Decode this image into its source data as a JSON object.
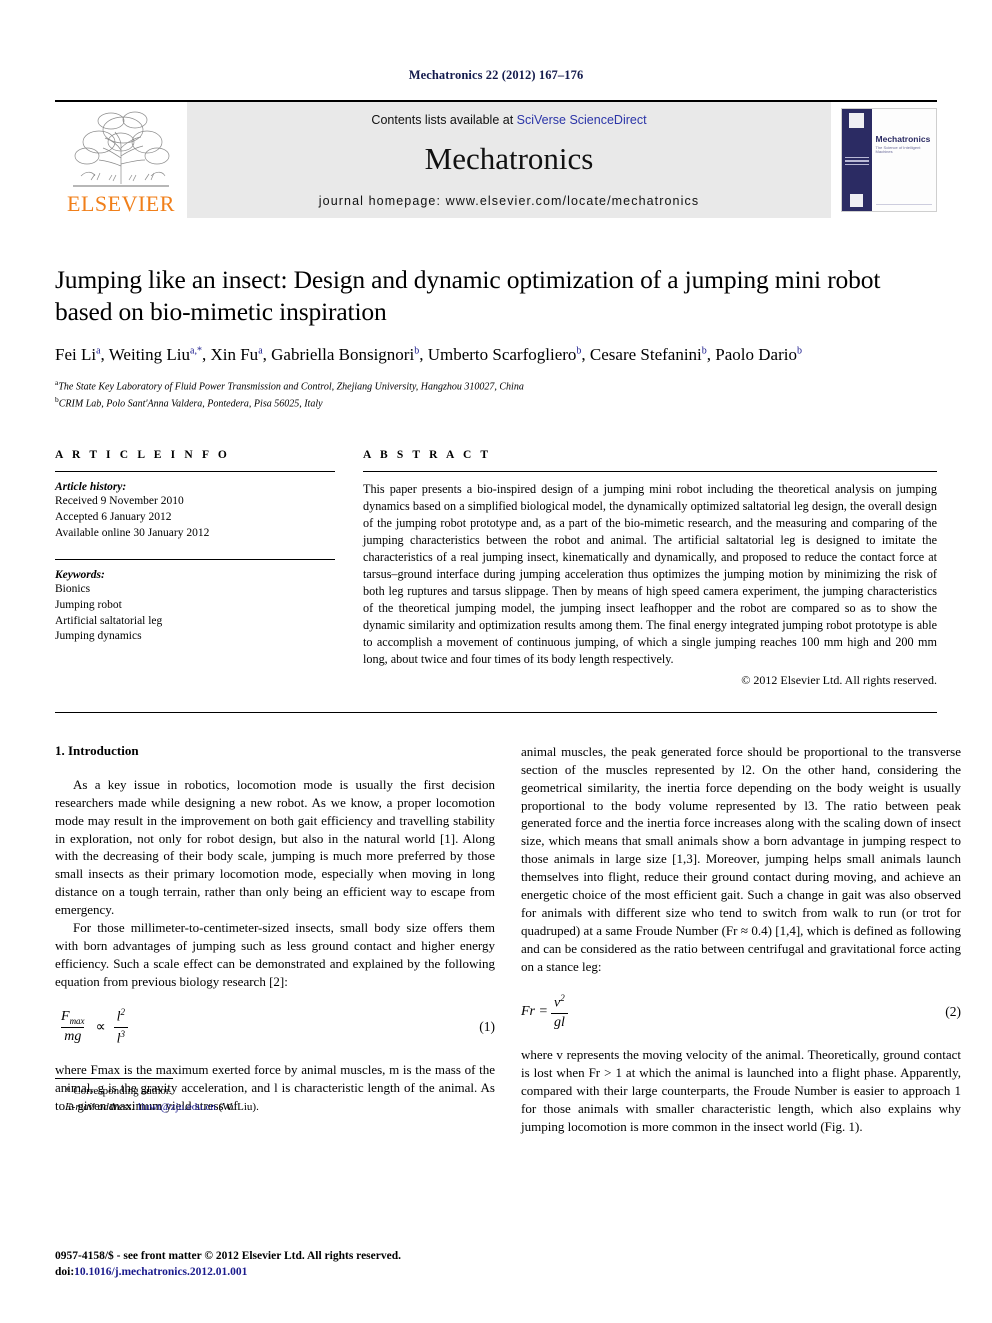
{
  "running_head": "Mechatronics 22 (2012) 167–176",
  "masthead": {
    "publisher_name": "ELSEVIER",
    "contents_prefix": "Contents lists available at ",
    "contents_link": "SciVerse ScienceDirect",
    "journal_title": "Mechatronics",
    "homepage": "journal homepage: www.elsevier.com/locate/mechatronics",
    "cover": {
      "title": "Mechatronics",
      "subtitle": "The Science of Intelligent Machines"
    }
  },
  "article": {
    "title": "Jumping like an insect: Design and dynamic optimization of a jumping mini robot based on bio-mimetic inspiration",
    "authors": [
      {
        "name": "Fei Li",
        "sup": "a"
      },
      {
        "name": "Weiting Liu",
        "sup": "a,*"
      },
      {
        "name": "Xin Fu",
        "sup": "a"
      },
      {
        "name": "Gabriella Bonsignori",
        "sup": "b"
      },
      {
        "name": "Umberto Scarfogliero",
        "sup": "b"
      },
      {
        "name": "Cesare Stefanini",
        "sup": "b"
      },
      {
        "name": "Paolo Dario",
        "sup": "b"
      }
    ],
    "affiliations": [
      {
        "mark": "a",
        "text": "The State Key Laboratory of Fluid Power Transmission and Control, Zhejiang University, Hangzhou 310027, China"
      },
      {
        "mark": "b",
        "text": "CRIM Lab, Polo Sant'Anna Valdera, Pontedera, Pisa 56025, Italy"
      }
    ]
  },
  "article_info": {
    "heading": "A R T I C L E   I N F O",
    "history_label": "Article history:",
    "history": [
      "Received 9 November 2010",
      "Accepted 6 January 2012",
      "Available online 30 January 2012"
    ],
    "keywords_label": "Keywords:",
    "keywords": [
      "Bionics",
      "Jumping robot",
      "Artificial saltatorial leg",
      "Jumping dynamics"
    ]
  },
  "abstract": {
    "heading": "A B S T R A C T",
    "text": "This paper presents a bio-inspired design of a jumping mini robot including the theoretical analysis on jumping dynamics based on a simplified biological model, the dynamically optimized saltatorial leg design, the overall design of the jumping robot prototype and, as a part of the bio-mimetic research, and the measuring and comparing of the jumping characteristics between the robot and animal. The artificial saltatorial leg is designed to imitate the characteristics of a real jumping insect, kinematically and dynamically, and proposed to reduce the contact force at tarsus–ground interface during jumping acceleration thus optimizes the jumping motion by minimizing the risk of both leg ruptures and tarsus slippage. Then by means of high speed camera experiment, the jumping characteristics of the theoretical jumping model, the jumping insect leafhopper and the robot are compared so as to show the dynamic similarity and optimization results among them. The final energy integrated jumping robot prototype is able to accomplish a movement of continuous jumping, of which a single jumping reaches 100 mm high and 200 mm long, about twice and four times of its body length respectively.",
    "copyright": "© 2012 Elsevier Ltd. All rights reserved."
  },
  "body": {
    "section_number_title": "1. Introduction",
    "left_paragraphs": [
      "As a key issue in robotics, locomotion mode is usually the first decision researchers made while designing a new robot. As we know, a proper locomotion mode may result in the improvement on both gait efficiency and travelling stability in exploration, not only for robot design, but also in the natural world [1]. Along with the decreasing of their body scale, jumping is much more preferred by those small insects as their primary locomotion mode, especially when moving in long distance on a tough terrain, rather than only being an efficient way to escape from emergency.",
      "For those millimeter-to-centimeter-sized insects, small body size offers them with born advantages of jumping such as less ground contact and higher energy efficiency. Such a scale effect can be demonstrated and explained by the following equation from previous biology research [2]:"
    ],
    "left_after_eq": "where Fmax is the maximum exerted force by animal muscles, m is the mass of the animal, g is the gravity acceleration, and l is characteristic length of the animal. As to a given maximum yield stress of",
    "right_paragraphs": [
      "animal muscles, the peak generated force should be proportional to the transverse section of the muscles represented by l2. On the other hand, considering the geometrical similarity, the inertia force depending on the body weight is usually proportional to the body volume represented by l3. The ratio between peak generated force and the inertia force increases along with the scaling down of insect size, which means that small animals show a born advantage in jumping respect to those animals in large size [1,3]. Moreover, jumping helps small animals launch themselves into flight, reduce their ground contact during moving, and achieve an energetic choice of the most efficient gait. Such a change in gait was also observed for animals with different size who tend to switch from walk to run (or trot for quadruped) at a same Froude Number (Fr ≈ 0.4) [1,4], which is defined as following and can be considered as the ratio between centrifugal and gravitational force acting on a stance leg:"
    ],
    "right_after_eq": "where v represents the moving velocity of the animal. Theoretically, ground contact is lost when Fr > 1 at which the animal is launched into a flight phase. Apparently, compared with their large counterparts, the Froude Number is easier to approach 1 for those animals with smaller characteristic length, which also explains why jumping locomotion is more common in the insect world (Fig. 1)."
  },
  "equations": {
    "eq1": {
      "num_left": "F",
      "num_left_sub": "max",
      "den_left": "mg",
      "operator": "∝",
      "num_right": "l",
      "num_right_sup": "2",
      "den_right": "l",
      "den_right_sup": "3",
      "label": "(1)"
    },
    "eq2": {
      "lhs": "Fr =",
      "num": "v",
      "num_sup": "2",
      "den": "gl",
      "label": "(2)"
    }
  },
  "footnotes": {
    "corresponding_mark": "*",
    "corresponding_text": "Corresponding author.",
    "email_label": "E-mail address:",
    "email": "liuwt@zju.edu.cn",
    "email_owner": "(W. Liu)."
  },
  "page_footer": {
    "issn_line": "0957-4158/$ - see front matter © 2012 Elsevier Ltd. All rights reserved.",
    "doi_label": "doi:",
    "doi": "10.1016/j.mechatronics.2012.01.001"
  },
  "colors": {
    "link_blue": "#2b35a8",
    "ref_blue": "#1a1a8c",
    "elsevier_orange": "#f07f1a",
    "band_gray": "#e9e9e9"
  }
}
